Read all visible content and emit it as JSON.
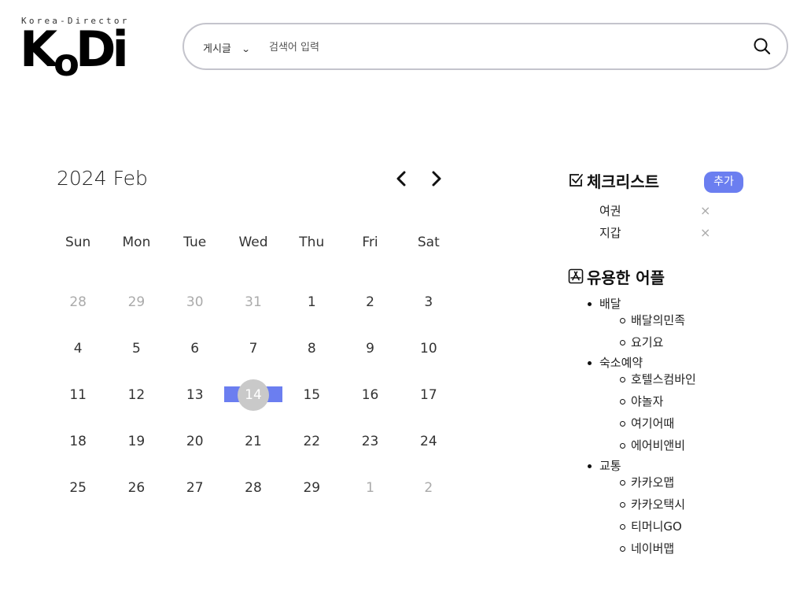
{
  "logo": {
    "tagline": "Korea-Director",
    "main_k": "K",
    "main_o": "o",
    "main_di": "Di"
  },
  "search": {
    "category": "게시글",
    "placeholder": "검색어 입력"
  },
  "calendar": {
    "year": "2024",
    "month": "Feb",
    "weekdays": [
      "Sun",
      "Mon",
      "Tue",
      "Wed",
      "Thu",
      "Fri",
      "Sat"
    ],
    "today": 14,
    "weeks": [
      [
        {
          "d": "28",
          "m": true
        },
        {
          "d": "29",
          "m": true
        },
        {
          "d": "30",
          "m": true
        },
        {
          "d": "31",
          "m": true
        },
        {
          "d": "1"
        },
        {
          "d": "2"
        },
        {
          "d": "3"
        }
      ],
      [
        {
          "d": "4"
        },
        {
          "d": "5"
        },
        {
          "d": "6"
        },
        {
          "d": "7"
        },
        {
          "d": "8"
        },
        {
          "d": "9"
        },
        {
          "d": "10"
        }
      ],
      [
        {
          "d": "11"
        },
        {
          "d": "12"
        },
        {
          "d": "13"
        },
        {
          "d": "14",
          "t": true
        },
        {
          "d": "15"
        },
        {
          "d": "16"
        },
        {
          "d": "17"
        }
      ],
      [
        {
          "d": "18"
        },
        {
          "d": "19"
        },
        {
          "d": "20"
        },
        {
          "d": "21"
        },
        {
          "d": "22"
        },
        {
          "d": "23"
        },
        {
          "d": "24"
        }
      ],
      [
        {
          "d": "25"
        },
        {
          "d": "26"
        },
        {
          "d": "27"
        },
        {
          "d": "28"
        },
        {
          "d": "29"
        },
        {
          "d": "1",
          "m": true
        },
        {
          "d": "2",
          "m": true
        }
      ]
    ]
  },
  "checklist": {
    "title": "체크리스트",
    "add_label": "추가",
    "items": [
      "여권",
      "지갑"
    ],
    "delete_glyph": "×"
  },
  "apps": {
    "title": "유용한 어플",
    "categories": [
      {
        "label": "배달",
        "apps": [
          "배달의민족",
          "요기요"
        ]
      },
      {
        "label": "숙소예약",
        "apps": [
          "호텔스컴바인",
          "야놀자",
          "여기어때",
          "에어비앤비"
        ]
      },
      {
        "label": "교통",
        "apps": [
          "카카오맵",
          "카카오택시",
          "티머니GO",
          "네이버맵"
        ]
      }
    ]
  },
  "colors": {
    "accent": "#6b7ef0",
    "today_circle": "#c9c9c9",
    "muted_text": "#aaaaaa"
  }
}
